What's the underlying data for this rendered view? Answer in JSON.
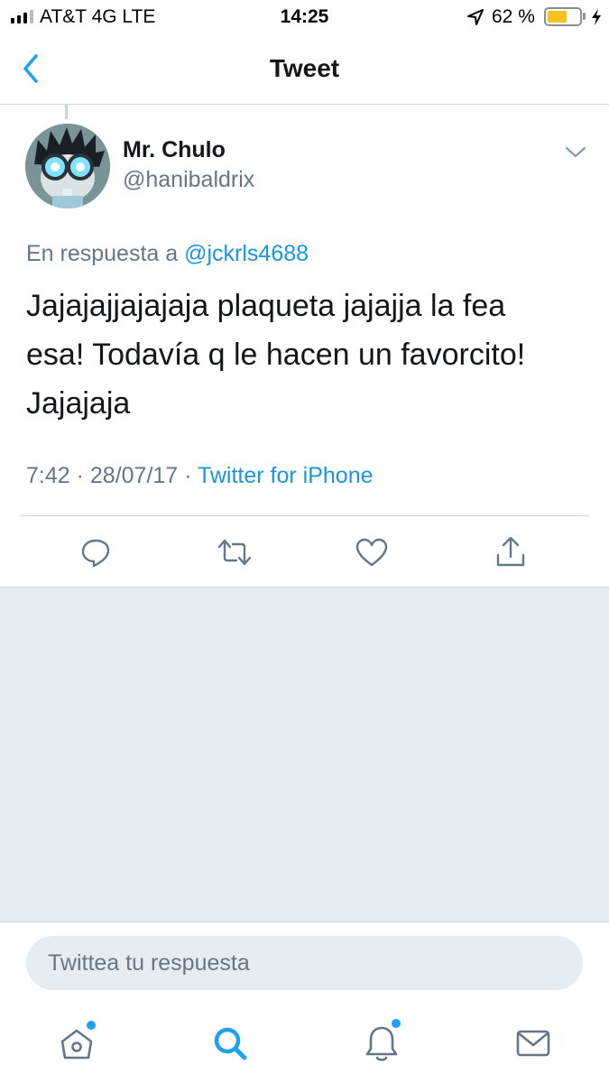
{
  "status_bar": {
    "carrier": "AT&T 4G   LTE",
    "time": "14:25",
    "battery_percent": "62 %",
    "battery_level": 0.62,
    "icons": [
      "signal-bars-icon",
      "location-arrow-icon",
      "battery-icon",
      "charging-bolt-icon"
    ]
  },
  "nav": {
    "title": "Tweet",
    "back_icon": "chevron-left-icon"
  },
  "tweet": {
    "author": {
      "display_name": "Mr. Chulo",
      "handle": "@hanibaldrix"
    },
    "reply_prefix": "En respuesta a ",
    "reply_to": "@jckrls4688",
    "text_lines": [
      "Jajajajjajajaja plaqueta jajajja la fea",
      "esa!  Todavía q le hacen un favorcito!",
      "Jajajaja"
    ],
    "time": "7:42",
    "date": "28/07/17",
    "separator": " · ",
    "source": "Twitter for iPhone",
    "actions": [
      "reply-icon",
      "retweet-icon",
      "like-icon",
      "share-icon"
    ]
  },
  "reply_box": {
    "placeholder": "Twittea tu respuesta"
  },
  "tab_bar": {
    "tabs": [
      "home-icon",
      "search-icon",
      "notifications-icon",
      "messages-icon"
    ],
    "accent_color": "#1da1f2"
  },
  "colors": {
    "link": "#1b95e0",
    "secondary_text": "#657786",
    "background_gray": "#e6ecf0",
    "battery": "#f7c31b"
  }
}
